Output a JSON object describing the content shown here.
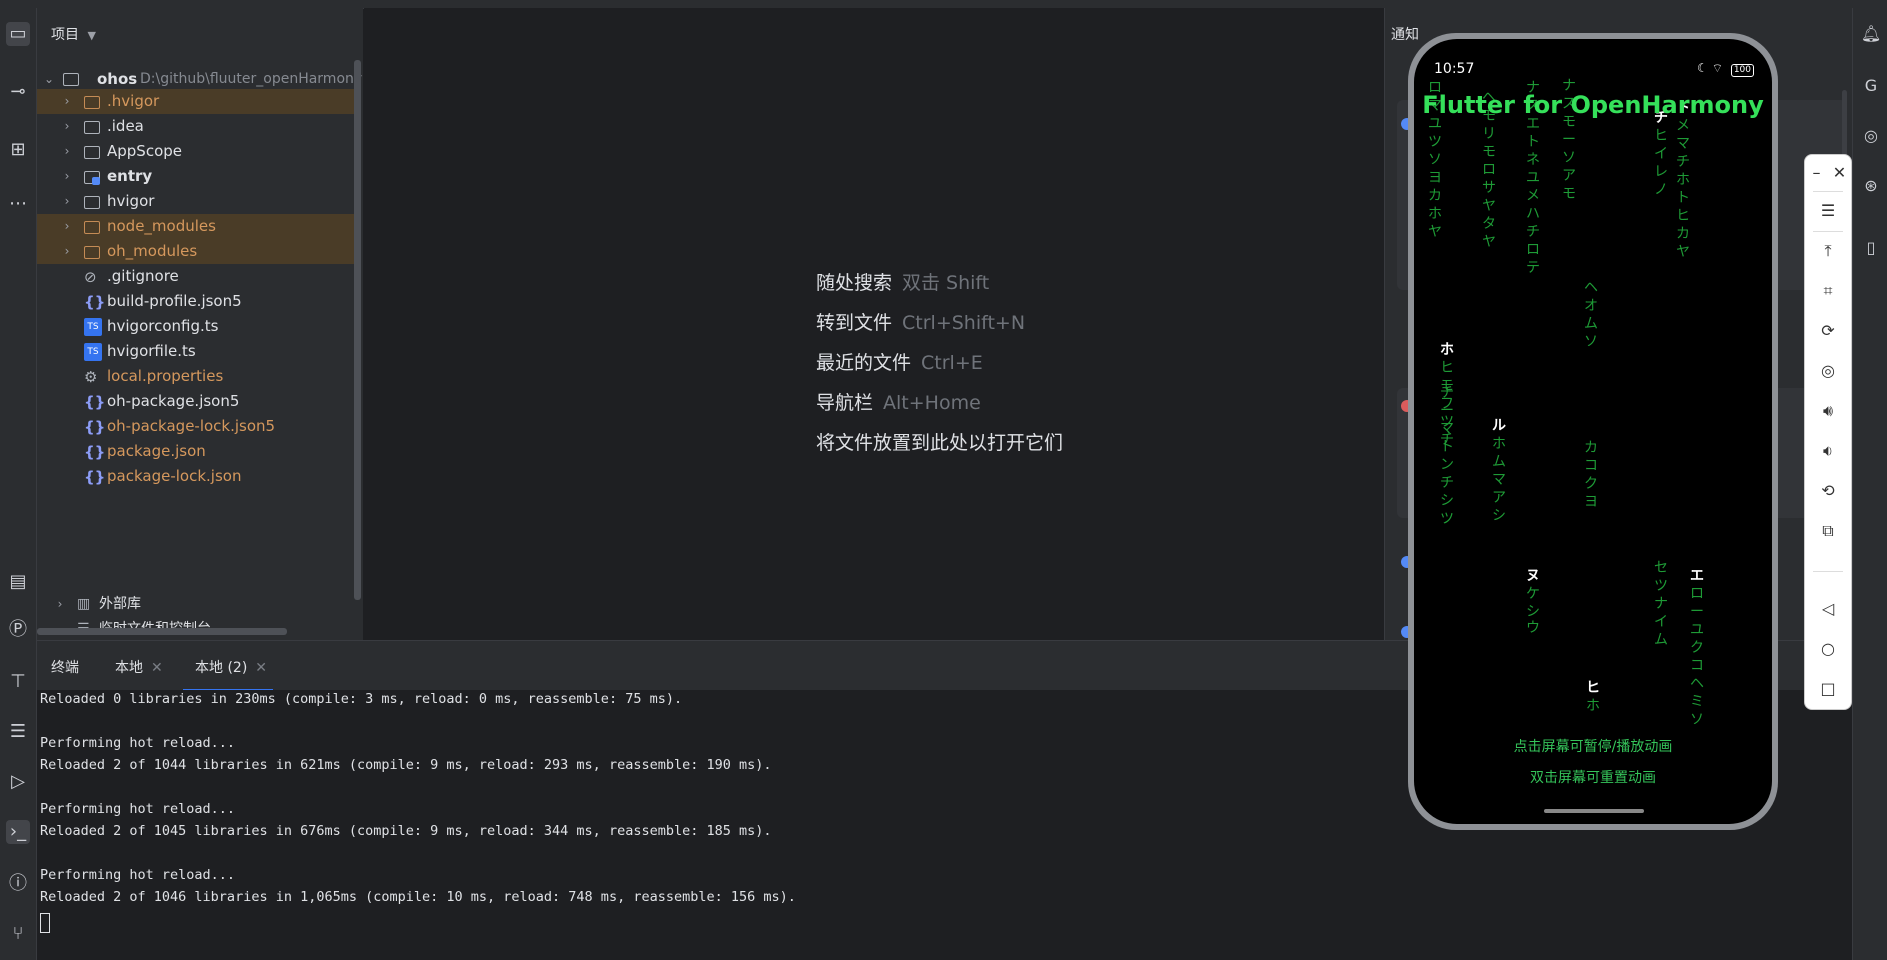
{
  "project": {
    "header_label": "项目",
    "root": {
      "name": "ohos",
      "path": "D:\\github\\fluuter_openHarmony"
    },
    "items": [
      {
        "label": ".hvigor",
        "kind": "folder",
        "ignored": true
      },
      {
        "label": ".idea",
        "kind": "folder",
        "ignored": false
      },
      {
        "label": "AppScope",
        "kind": "folder",
        "ignored": false
      },
      {
        "label": "entry",
        "kind": "module",
        "ignored": false
      },
      {
        "label": "hvigor",
        "kind": "folder",
        "ignored": false
      },
      {
        "label": "node_modules",
        "kind": "folder",
        "ignored": true
      },
      {
        "label": "oh_modules",
        "kind": "folder",
        "ignored": true
      },
      {
        "label": ".gitignore",
        "kind": "ignore-file",
        "ignored": false
      },
      {
        "label": "build-profile.json5",
        "kind": "json",
        "ignored": false
      },
      {
        "label": "hvigorconfig.ts",
        "kind": "ts",
        "ignored": false
      },
      {
        "label": "hvigorfile.ts",
        "kind": "ts",
        "ignored": false
      },
      {
        "label": "local.properties",
        "kind": "properties",
        "ignored": false
      },
      {
        "label": "oh-package.json5",
        "kind": "json",
        "ignored": false
      },
      {
        "label": "oh-package-lock.json5",
        "kind": "json",
        "ignored": false
      },
      {
        "label": "package.json",
        "kind": "json",
        "ignored": false
      },
      {
        "label": "package-lock.json",
        "kind": "json",
        "ignored": false
      }
    ],
    "external_libs": "外部库",
    "scratches": "临时文件和控制台"
  },
  "editor_hints": [
    {
      "action": "随处搜索",
      "shortcut": "双击 Shift"
    },
    {
      "action": "转到文件",
      "shortcut": "Ctrl+Shift+N"
    },
    {
      "action": "最近的文件",
      "shortcut": "Ctrl+E"
    },
    {
      "action": "导航栏",
      "shortcut": "Alt+Home"
    },
    {
      "action": "将文件放置到此处以打开它们",
      "shortcut": ""
    }
  ],
  "notifications": {
    "title": "通知"
  },
  "terminal": {
    "tabs": [
      {
        "label": "终端"
      },
      {
        "label": "本地"
      },
      {
        "label": "本地 (2)"
      }
    ],
    "lines": [
      "Reloaded 0 libraries in 230ms (compile: 3 ms, reload: 0 ms, reassemble: 75 ms).",
      "",
      "Performing hot reload...",
      "Reloaded 2 of 1044 libraries in 621ms (compile: 9 ms, reload: 293 ms, reassemble: 190 ms).",
      "",
      "Performing hot reload...",
      "Reloaded 2 of 1045 libraries in 676ms (compile: 9 ms, reload: 344 ms, reassemble: 185 ms).",
      "",
      "Performing hot reload...",
      "Reloaded 2 of 1046 libraries in 1,065ms (compile: 10 ms, reload: 748 ms, reassemble: 156 ms)."
    ]
  },
  "phone": {
    "time": "10:57",
    "battery": "100",
    "app_title": "Flutter for OpenHarmony",
    "hint_pause": "点击屏幕可暂停/播放动画",
    "hint_reset": "双击屏幕可重置动画",
    "rain_columns": [
      {
        "text": "ロマユツソヨカホヤ",
        "head": ""
      },
      {
        "text": "ヒモフツチ",
        "head": "ホ"
      },
      {
        "text": "チーマトンチシツ",
        "head": ""
      },
      {
        "text": "ヘモリモロサヤタヤ",
        "head": ""
      },
      {
        "text": "ホムマアシ",
        "head": "ル"
      },
      {
        "text": "ナスエトネユメハチロテ",
        "head": ""
      },
      {
        "text": "ケシ",
        "head": "ヌ"
      },
      {
        "text": "ウ",
        "head": ""
      },
      {
        "text": "ナスモーソアモ",
        "head": ""
      },
      {
        "text": "ヘオムソ",
        "head": ""
      },
      {
        "text": "カコクヨ",
        "head": ""
      },
      {
        "text": "ホ",
        "head": "ヒ"
      },
      {
        "text": "ヒイレノ",
        "head": "チ"
      },
      {
        "text": "セツナイム",
        "head": ""
      },
      {
        "text": "メマチホトヒカヤ",
        "head": "ト"
      },
      {
        "text": "ローユクコヘミソ",
        "head": "エ"
      }
    ],
    "accent_color": "#35e05a"
  },
  "emulator_controls": [
    {
      "label": "minimize",
      "icon": "minus-icon"
    },
    {
      "label": "close",
      "icon": "close-icon"
    },
    {
      "label": "menu",
      "icon": "menu-icon"
    },
    {
      "label": "pin-top",
      "icon": "pin-top-icon"
    },
    {
      "label": "crop",
      "icon": "crop-icon"
    },
    {
      "label": "rotate",
      "icon": "rotate-icon"
    },
    {
      "label": "screenshot",
      "icon": "screenshot-icon"
    },
    {
      "label": "volume-up",
      "icon": "volume-up-icon"
    },
    {
      "label": "volume-down",
      "icon": "volume-down-icon"
    },
    {
      "label": "shake",
      "icon": "shake-icon"
    },
    {
      "label": "multi-device",
      "icon": "multi-device-icon"
    },
    {
      "label": "back",
      "icon": "back-icon"
    },
    {
      "label": "home",
      "icon": "home-icon"
    },
    {
      "label": "recents",
      "icon": "recents-icon"
    }
  ]
}
